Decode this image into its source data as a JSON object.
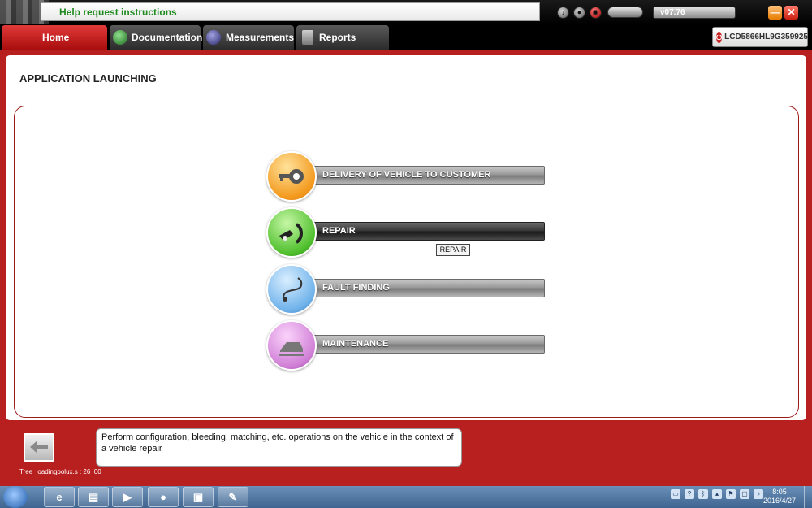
{
  "topbar": {
    "help_text": "Help request instructions",
    "version": "v07.76"
  },
  "tabs": [
    {
      "label": "Home"
    },
    {
      "label": "Documentation"
    },
    {
      "label": "Measurements"
    },
    {
      "label": "Reports"
    }
  ],
  "vin": "LCD5866HL9G359925",
  "page": {
    "title": "APPLICATION LAUNCHING"
  },
  "apps": [
    {
      "label": "DELIVERY OF VEHICLE TO CUSTOMER",
      "icon": "key-car-icon",
      "color": "#f39a1e"
    },
    {
      "label": "REPAIR",
      "icon": "repair-tool-icon",
      "color": "#4fbf2d"
    },
    {
      "label": "FAULT FINDING",
      "icon": "stethoscope-icon",
      "color": "#6fb2ea"
    },
    {
      "label": "MAINTENANCE",
      "icon": "car-lift-icon",
      "color": "#d07fd6"
    }
  ],
  "tooltip": "REPAIR",
  "description": "Perform configuration, bleeding, matching, etc. operations on the vehicle in the context of a vehicle repair",
  "status_text": "Tree_loadingpolux.s : 26_00",
  "taskbar": {
    "time": "8:05",
    "date": "2016/4/27"
  }
}
